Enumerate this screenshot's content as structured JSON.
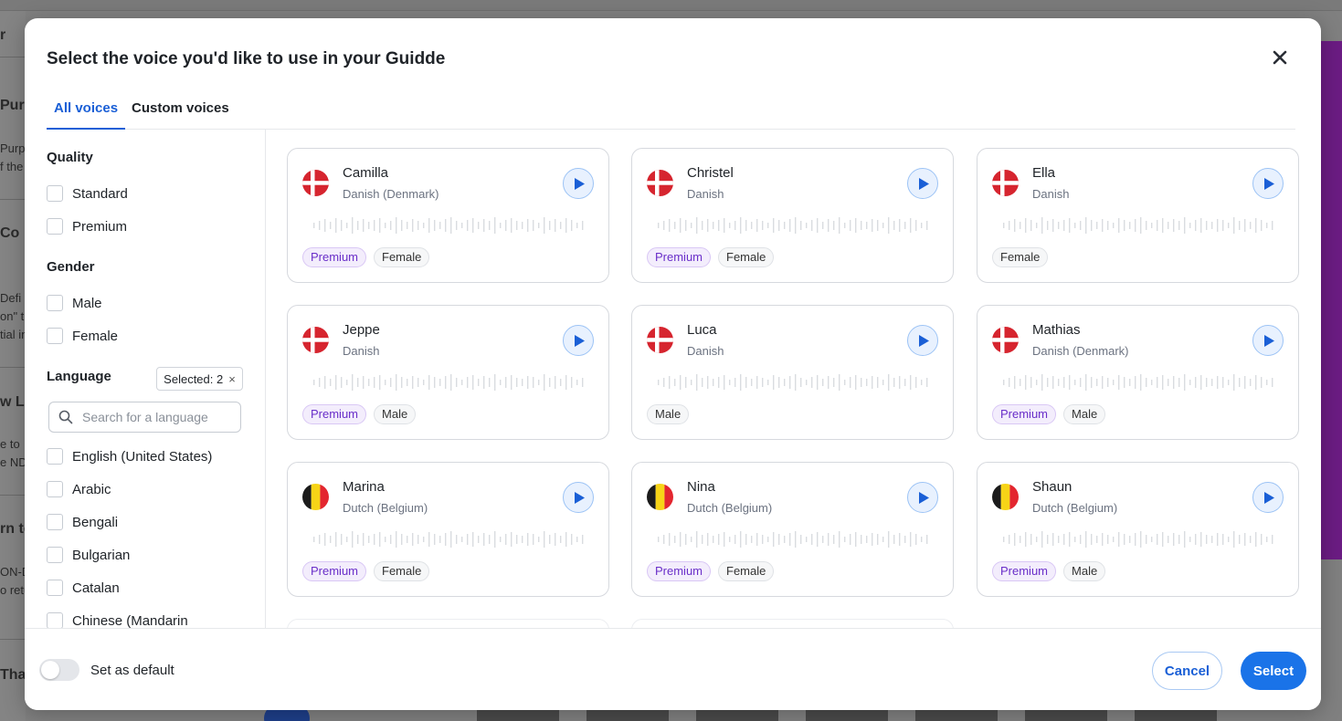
{
  "background": {
    "left_headings": [
      "r",
      "Pur",
      "Co",
      "w Li",
      "rn to",
      "Thar"
    ],
    "left_snippets": [
      "Purp",
      "f the",
      "Defi",
      "on\" t",
      "tial in",
      "e to",
      "e ND",
      "ON-D",
      "o retu"
    ]
  },
  "modal": {
    "title": "Select the voice you'd like to use in your Guidde",
    "tabs": [
      {
        "label": "All voices",
        "active": true
      },
      {
        "label": "Custom voices",
        "active": false
      }
    ]
  },
  "filters": {
    "quality": {
      "title": "Quality",
      "options": [
        "Standard",
        "Premium"
      ]
    },
    "gender": {
      "title": "Gender",
      "options": [
        "Male",
        "Female"
      ]
    },
    "language": {
      "title": "Language",
      "selected_label": "Selected: 2",
      "clear_glyph": "×",
      "search_placeholder": "Search for a language",
      "options": [
        "English (United States)",
        "Arabic",
        "Bengali",
        "Bulgarian",
        "Catalan",
        "Chinese (Mandarin"
      ]
    }
  },
  "voices": [
    {
      "name": "Camilla",
      "language": "Danish (Denmark)",
      "flag": "denmark",
      "tags": [
        "Premium",
        "Female"
      ]
    },
    {
      "name": "Christel",
      "language": "Danish",
      "flag": "denmark",
      "tags": [
        "Premium",
        "Female"
      ]
    },
    {
      "name": "Ella",
      "language": "Danish",
      "flag": "denmark",
      "tags": [
        "Female"
      ]
    },
    {
      "name": "Jeppe",
      "language": "Danish",
      "flag": "denmark",
      "tags": [
        "Premium",
        "Male"
      ]
    },
    {
      "name": "Luca",
      "language": "Danish",
      "flag": "denmark",
      "tags": [
        "Male"
      ]
    },
    {
      "name": "Mathias",
      "language": "Danish (Denmark)",
      "flag": "denmark",
      "tags": [
        "Premium",
        "Male"
      ]
    },
    {
      "name": "Marina",
      "language": "Dutch (Belgium)",
      "flag": "belgium",
      "tags": [
        "Premium",
        "Female"
      ]
    },
    {
      "name": "Nina",
      "language": "Dutch (Belgium)",
      "flag": "belgium",
      "tags": [
        "Premium",
        "Female"
      ]
    },
    {
      "name": "Shaun",
      "language": "Dutch (Belgium)",
      "flag": "belgium",
      "tags": [
        "Premium",
        "Male"
      ]
    }
  ],
  "footer": {
    "toggle_label": "Set as default",
    "toggle_on": false,
    "cancel_label": "Cancel",
    "select_label": "Select"
  },
  "colors": {
    "accent": "#1a73e8",
    "premium_text": "#6a2fc9",
    "denmark_red": "#d6252f",
    "belgium_black": "#1b1b1b",
    "belgium_yellow": "#f7d417",
    "belgium_red": "#e3262f"
  },
  "icons": {
    "close": "close-icon",
    "search": "search-icon",
    "play": "play-icon"
  }
}
